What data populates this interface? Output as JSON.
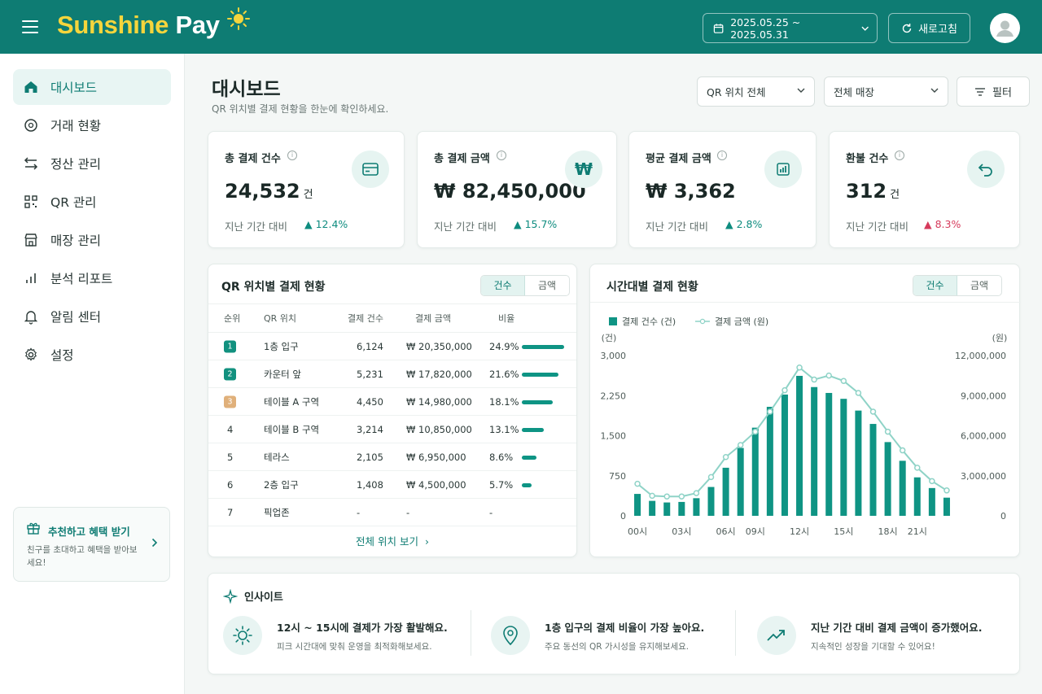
{
  "topbar": {
    "brand_part1": "Sunshine",
    "brand_part2": "Pay",
    "date_range": "2025.05.25 ~ 2025.05.31",
    "refresh_label": "새로고침"
  },
  "sidebar": {
    "items": [
      {
        "label": "대시보드",
        "icon": "home-icon"
      },
      {
        "label": "거래 현황",
        "icon": "coin-icon"
      },
      {
        "label": "정산 관리",
        "icon": "transfer-icon"
      },
      {
        "label": "QR 관리",
        "icon": "qr-code-icon"
      },
      {
        "label": "매장 관리",
        "icon": "store-icon"
      },
      {
        "label": "분석 리포트",
        "icon": "bar-chart-icon"
      },
      {
        "label": "알림 센터",
        "icon": "bell-icon"
      },
      {
        "label": "설정",
        "icon": "gear-icon"
      }
    ],
    "promo": {
      "title": "추천하고 혜택 받기",
      "desc": "친구를 초대하고 혜택을 받아보세요!"
    }
  },
  "header": {
    "title": "대시보드",
    "subtitle": "QR 위치별 결제 현황을 한눈에 확인하세요.",
    "location_select": "QR 위치 전체",
    "sales_select": "전체 매장",
    "filter_label": "필터"
  },
  "kpis": [
    {
      "title": "총 결제 건수",
      "value": "24,532",
      "unit": "건",
      "compare": "지난 기간 대비",
      "delta": "12.4%",
      "direction": "up",
      "icon": "card-icon"
    },
    {
      "title": "총 결제 금액",
      "value": "₩ 82,450,000",
      "unit": "",
      "compare": "지난 기간 대비",
      "delta": "15.7%",
      "direction": "up",
      "icon": "won-icon"
    },
    {
      "title": "평균 결제 금액",
      "value": "₩ 3,362",
      "unit": "",
      "compare": "지난 기간 대비",
      "delta": "2.8%",
      "direction": "up",
      "icon": "bar-chart-icon"
    },
    {
      "title": "환불 건수",
      "value": "312",
      "unit": "건",
      "compare": "지난 기간 대비",
      "delta": "8.3%",
      "direction": "up-negative",
      "icon": "undo-icon"
    }
  ],
  "qr_table": {
    "title": "QR 위치별 결제 현황",
    "toggle": [
      "건수",
      "금액"
    ],
    "columns": [
      "순위",
      "QR 위치",
      "결제 건수",
      "결제 금액",
      "비율"
    ],
    "rows": [
      {
        "rank": "1",
        "location": "1층 입구",
        "count": "6,124",
        "amount": "₩ 20,350,000",
        "ratio": "24.9%",
        "ratio_value": 24.9
      },
      {
        "rank": "2",
        "location": "카운터 앞",
        "count": "5,231",
        "amount": "₩ 17,820,000",
        "ratio": "21.6%",
        "ratio_value": 21.6
      },
      {
        "rank": "3",
        "location": "테이블 A 구역",
        "count": "4,450",
        "amount": "₩ 14,980,000",
        "ratio": "18.1%",
        "ratio_value": 18.1
      },
      {
        "rank": "4",
        "location": "테이블 B 구역",
        "count": "3,214",
        "amount": "₩ 10,850,000",
        "ratio": "13.1%",
        "ratio_value": 13.1
      },
      {
        "rank": "5",
        "location": "테라스",
        "count": "2,105",
        "amount": "₩ 6,950,000",
        "ratio": "8.6%",
        "ratio_value": 8.6
      },
      {
        "rank": "6",
        "location": "2층 입구",
        "count": "1,408",
        "amount": "₩ 4,500,000",
        "ratio": "5.7%",
        "ratio_value": 5.7
      },
      {
        "rank": "7",
        "location": "픽업존",
        "count": "-",
        "amount": "-",
        "ratio": "-",
        "ratio_value": 0
      }
    ],
    "see_all": "전체 위치 보기",
    "badge_colors": {
      "1": "#12917f",
      "2": "#12917f",
      "3": "#e0b07a"
    }
  },
  "hourly": {
    "title": "시간대별 결제 현황",
    "toggle": [
      "건수",
      "금액"
    ],
    "legend_count": "결제 건수 (건)",
    "legend_amount": "결제 금액 (원)",
    "left_unit": "(건)",
    "right_unit": "(원)"
  },
  "chart_data": {
    "type": "bar",
    "x": [
      "00시",
      "01시",
      "02시",
      "03시",
      "04시",
      "05시",
      "06시",
      "07시",
      "08시",
      "09시",
      "10시",
      "11시",
      "12시",
      "13시",
      "14시",
      "15시",
      "16시",
      "17시",
      "18시",
      "19시",
      "20시",
      "21시",
      "22시",
      "23시"
    ],
    "x_tick_labels": [
      "00시",
      "03시",
      "06시",
      "09시",
      "12시",
      "15시",
      "18시",
      "21시"
    ],
    "series": [
      {
        "name": "결제 건수 (건)",
        "type": "bar",
        "axis": "left",
        "color": "#0f9484",
        "values": [
          410,
          280,
          250,
          260,
          330,
          540,
          900,
          1270,
          1650,
          2040,
          2270,
          2620,
          2410,
          2300,
          2190,
          1970,
          1720,
          1380,
          1030,
          720,
          520,
          340
        ]
      },
      {
        "name": "결제 금액 (원)",
        "type": "line",
        "axis": "right",
        "color": "#8fd3c7",
        "values": [
          2400000,
          1500000,
          1450000,
          1450000,
          1700000,
          2900000,
          4400000,
          5300000,
          6300000,
          7800000,
          9400000,
          11100000,
          10200000,
          10500000,
          10100000,
          9200000,
          7800000,
          6300000,
          4900000,
          3600000,
          2600000,
          1900000
        ]
      }
    ],
    "count_bar_hours": [
      "00시",
      "01시",
      "02시",
      "03시",
      "04시",
      "05시",
      "06시",
      "07시",
      "08시",
      "09시",
      "10시",
      "11시",
      "12시",
      "13시",
      "14시",
      "15시",
      "16시",
      "17시",
      "18시",
      "19시",
      "20시",
      "21시",
      "22시",
      "23시"
    ],
    "left_ticks": [
      "3,000",
      "2,250",
      "1,500",
      "750",
      "0"
    ],
    "right_ticks": [
      "12,000,000",
      "9,000,000",
      "6,000,000",
      "3,000,000",
      "0"
    ],
    "ylim_left": [
      0,
      3000
    ],
    "ylim_right": [
      0,
      12000000
    ]
  },
  "insights": {
    "title": "인사이트",
    "items": [
      {
        "title": "12시 ~ 15시에 결제가 가장 활발해요.",
        "desc": "피크 시간대에 맞춰 운영을 최적화해보세요.",
        "icon": "sun-icon"
      },
      {
        "title": "1층 입구의 결제 비율이 가장 높아요.",
        "desc": "주요 동선의 QR 가시성을 유지해보세요.",
        "icon": "location-pin-icon"
      },
      {
        "title": "지난 기간 대비 결제 금액이 증가했어요.",
        "desc": "지속적인 성장을 기대할 수 있어요!",
        "icon": "trend-up-icon"
      }
    ]
  },
  "colors": {
    "brand": "#0e7c73",
    "accent_yellow": "#f5d53c",
    "bar": "#0f9484",
    "line": "#8fd3c7",
    "negative": "#d63b5c"
  }
}
